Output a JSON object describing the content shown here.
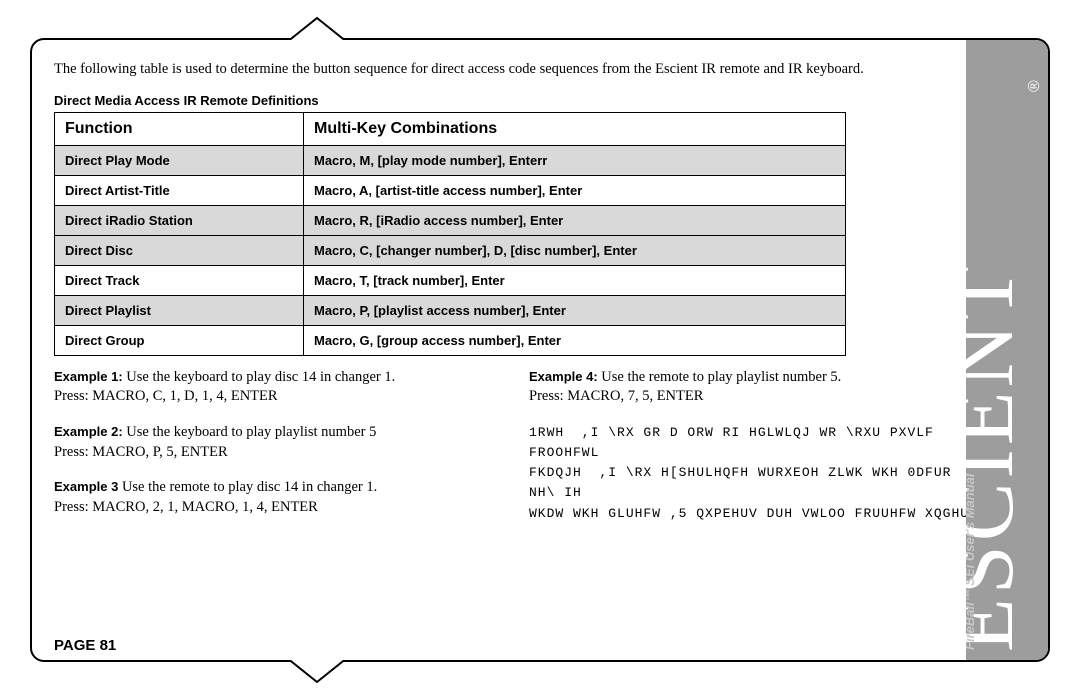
{
  "intro": "The following table is used to determine the button sequence for direct access code sequences from the Escient IR remote and IR keyboard.",
  "tableTitle": "Direct Media Access IR Remote Definitions",
  "headers": {
    "fn": "Function",
    "combo": "Multi-Key Combinations"
  },
  "rows": [
    {
      "fn": "Direct Play Mode",
      "combo": "Macro, M, [play mode number], Enterr",
      "shade": true
    },
    {
      "fn": "Direct Artist-Title",
      "combo": "Macro, A, [artist-title access number], Enter",
      "shade": false
    },
    {
      "fn": "Direct iRadio Station",
      "combo": "Macro, R, [iRadio access number], Enter",
      "shade": true
    },
    {
      "fn": "Direct Disc",
      "combo": "Macro, C, [changer number], D, [disc number], Enter",
      "shade": true
    },
    {
      "fn": "Direct Track",
      "combo": "Macro, T, [track number], Enter",
      "shade": false
    },
    {
      "fn": "Direct Playlist",
      "combo": "Macro, P, [playlist access number], Enter",
      "shade": true
    },
    {
      "fn": "Direct Group",
      "combo": "Macro, G, [group access number], Enter",
      "shade": false
    }
  ],
  "examplesLeft": [
    {
      "label": "Example 1:",
      "text": "Use the keyboard to play disc 14 in changer 1.",
      "press": "Press: MACRO, C, 1, D, 1, 4, ENTER"
    },
    {
      "label": "Example 2:",
      "text": "Use the keyboard to play playlist number 5",
      "press": "Press: MACRO, P, 5, ENTER"
    },
    {
      "label": "Example 3",
      "text": "Use the remote to play disc 14 in changer 1.",
      "press": "Press: MACRO, 2, 1, MACRO, 1, 4, ENTER"
    }
  ],
  "examplesRight": [
    {
      "label": "Example 4:",
      "text": "Use the remote to play playlist number 5.",
      "press": "Press: MACRO, 7, 5, ENTER"
    }
  ],
  "scrambledNote": "1RWH  ,I \\RX GR D ORW RI HGLWLQJ WR \\RXU PXVLF FROOHFWL\nFKDQJH  ,I \\RX H[SHULHQFH WURXEOH ZLWK WKH 0DFUR NH\\ IH\nWKDW WKH GLUHFW ,5 QXPEHUV DUH VWLOO FRUUHFW XQGHU",
  "pageLabel": "PAGE 81",
  "brand": {
    "name": "ESCIENT",
    "product": "FireBall™ SEi User's Manual"
  }
}
